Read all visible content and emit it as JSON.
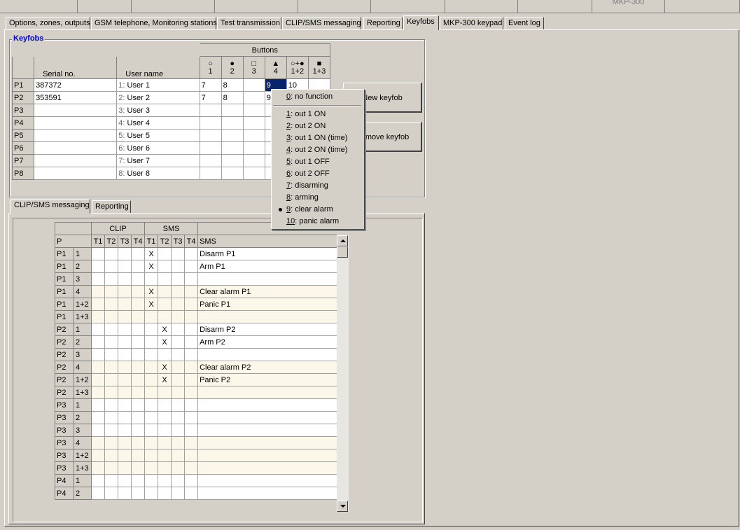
{
  "header": {
    "mkp_label": "MKP-300"
  },
  "tabs": [
    {
      "label": "Options, zones, outputs"
    },
    {
      "label": "GSM telephone, Monitoring stations"
    },
    {
      "label": "Test transmission"
    },
    {
      "label": "CLIP/SMS messaging"
    },
    {
      "label": "Reporting"
    },
    {
      "label": "Keyfobs"
    },
    {
      "label": "MKP-300 keypad"
    },
    {
      "label": "Event log"
    }
  ],
  "keyfobs": {
    "title": "Keyfobs",
    "buttons_header": "Buttons",
    "col_serial": "Serial no.",
    "col_user": "User name",
    "button_cols": [
      {
        "icon": "○",
        "label": "1"
      },
      {
        "icon": "●",
        "label": "2"
      },
      {
        "icon": "□",
        "label": "3"
      },
      {
        "icon": "▲",
        "label": "4"
      },
      {
        "icon": "○+●",
        "label": "1+2"
      },
      {
        "icon": "■",
        "label": "1+3"
      }
    ],
    "rows": [
      {
        "p": "P1",
        "serial": "387372",
        "num": "1:",
        "user": "User 1",
        "b": [
          "7",
          "8",
          "",
          "9",
          "10",
          ""
        ]
      },
      {
        "p": "P2",
        "serial": "353591",
        "num": "2:",
        "user": "User 2",
        "b": [
          "7",
          "8",
          "",
          "9",
          "",
          ""
        ]
      },
      {
        "p": "P3",
        "serial": "",
        "num": "3:",
        "user": "User 3",
        "b": [
          "",
          "",
          "",
          "",
          "",
          ""
        ]
      },
      {
        "p": "P4",
        "serial": "",
        "num": "4:",
        "user": "User 4",
        "b": [
          "",
          "",
          "",
          "",
          "",
          ""
        ]
      },
      {
        "p": "P5",
        "serial": "",
        "num": "5:",
        "user": "User 5",
        "b": [
          "",
          "",
          "",
          "",
          "",
          ""
        ]
      },
      {
        "p": "P6",
        "serial": "",
        "num": "6:",
        "user": "User 6",
        "b": [
          "",
          "",
          "",
          "",
          "",
          ""
        ]
      },
      {
        "p": "P7",
        "serial": "",
        "num": "7:",
        "user": "User 7",
        "b": [
          "",
          "",
          "",
          "",
          "",
          ""
        ]
      },
      {
        "p": "P8",
        "serial": "",
        "num": "8:",
        "user": "User 8",
        "b": [
          "",
          "",
          "",
          "",
          "",
          ""
        ]
      }
    ],
    "new_button": "New keyfob",
    "remove_button": "Remove keyfob"
  },
  "popup": {
    "items": [
      {
        "key": "0",
        "text": ": no function"
      },
      {
        "key": "1",
        "text": ": out 1 ON"
      },
      {
        "key": "2",
        "text": ": out 2 ON"
      },
      {
        "key": "3",
        "text": ": out 1 ON (time)"
      },
      {
        "key": "4",
        "text": ": out 2 ON (time)"
      },
      {
        "key": "5",
        "text": ": out 1 OFF"
      },
      {
        "key": "6",
        "text": ": out 2 OFF"
      },
      {
        "key": "7",
        "text": ": disarming"
      },
      {
        "key": "8",
        "text": ": arming"
      },
      {
        "key": "9",
        "text": ": clear alarm"
      },
      {
        "key": "10",
        "text": ": panic alarm"
      }
    ],
    "selected": "9"
  },
  "subtabs": [
    {
      "label": "CLIP/SMS messaging"
    },
    {
      "label": "Reporting"
    }
  ],
  "clip_sms": {
    "group_clip": "CLIP",
    "group_sms": "SMS",
    "col_p": "P",
    "cols_t": [
      "T1",
      "T2",
      "T3",
      "T4",
      "T1",
      "T2",
      "T3",
      "T4"
    ],
    "col_sms": "SMS",
    "mark": "X",
    "rows": [
      {
        "p": "P1",
        "btn": "1",
        "x": [
          4
        ],
        "sms": "Disarm P1"
      },
      {
        "p": "P1",
        "btn": "2",
        "x": [
          4
        ],
        "sms": "Arm P1"
      },
      {
        "p": "P1",
        "btn": "3",
        "x": [],
        "sms": ""
      },
      {
        "p": "P1",
        "btn": "4",
        "x": [
          4
        ],
        "sms": "Clear alarm P1"
      },
      {
        "p": "P1",
        "btn": "1+2",
        "x": [
          4
        ],
        "sms": "Panic P1"
      },
      {
        "p": "P1",
        "btn": "1+3",
        "x": [],
        "sms": ""
      },
      {
        "p": "P2",
        "btn": "1",
        "x": [
          5
        ],
        "sms": "Disarm P2"
      },
      {
        "p": "P2",
        "btn": "2",
        "x": [
          5
        ],
        "sms": "Arm P2"
      },
      {
        "p": "P2",
        "btn": "3",
        "x": [],
        "sms": ""
      },
      {
        "p": "P2",
        "btn": "4",
        "x": [
          5
        ],
        "sms": "Clear alarm P2"
      },
      {
        "p": "P2",
        "btn": "1+2",
        "x": [
          5
        ],
        "sms": "Panic P2"
      },
      {
        "p": "P2",
        "btn": "1+3",
        "x": [],
        "sms": ""
      },
      {
        "p": "P3",
        "btn": "1",
        "x": [],
        "sms": ""
      },
      {
        "p": "P3",
        "btn": "2",
        "x": [],
        "sms": ""
      },
      {
        "p": "P3",
        "btn": "3",
        "x": [],
        "sms": ""
      },
      {
        "p": "P3",
        "btn": "4",
        "x": [],
        "sms": ""
      },
      {
        "p": "P3",
        "btn": "1+2",
        "x": [],
        "sms": ""
      },
      {
        "p": "P3",
        "btn": "1+3",
        "x": [],
        "sms": ""
      },
      {
        "p": "P4",
        "btn": "1",
        "x": [],
        "sms": ""
      },
      {
        "p": "P4",
        "btn": "2",
        "x": [],
        "sms": ""
      }
    ]
  },
  "colors": {
    "face": "#d4d0c8",
    "group_title": "#0000cc",
    "cell_selected": "#0a246a",
    "row_tint_odd": "#fbf8e9"
  }
}
